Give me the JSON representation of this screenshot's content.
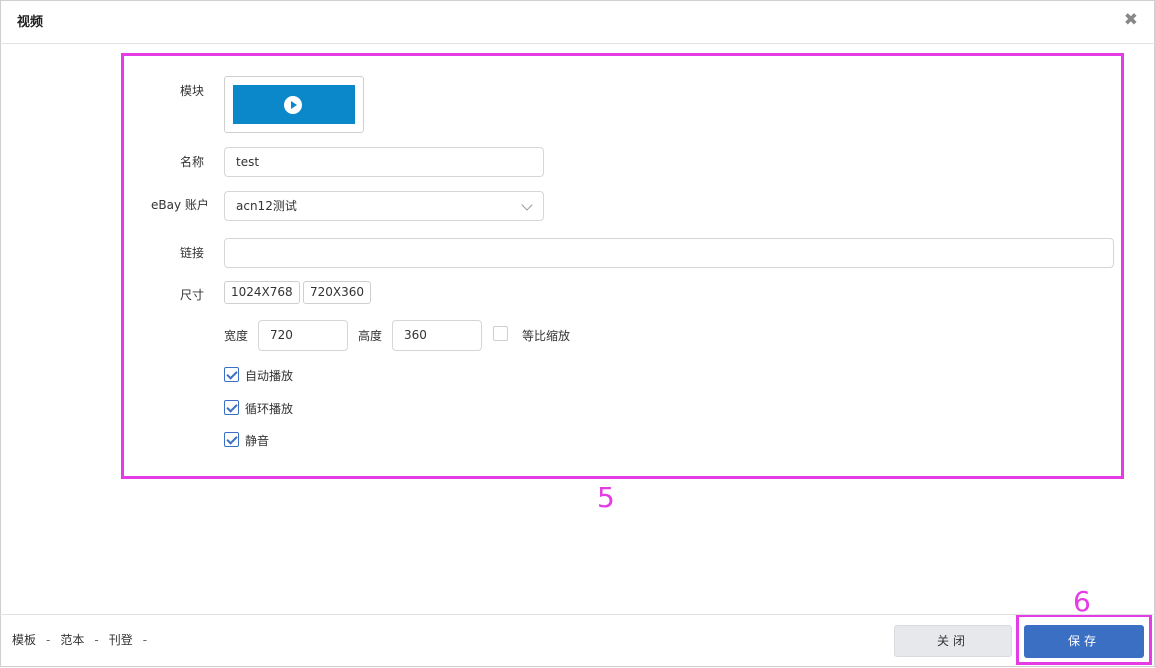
{
  "dialog": {
    "title": "视频",
    "close_glyph": "✖"
  },
  "form": {
    "module_label": "模块",
    "name_label": "名称",
    "name_value": "test",
    "account_label": "eBay 账户",
    "account_value": "acn12测试",
    "link_label": "链接",
    "link_value": "",
    "size_label": "尺寸",
    "size_presets": [
      "1024X768",
      "720X360"
    ],
    "width_label": "宽度",
    "width_value": "720",
    "height_label": "高度",
    "height_value": "360",
    "proportional_label": "等比缩放",
    "proportional_checked": false,
    "autoplay_label": "自动播放",
    "autoplay_checked": true,
    "loop_label": "循环播放",
    "loop_checked": true,
    "mute_label": "静音",
    "mute_checked": true
  },
  "footer": {
    "breadcrumb": [
      "模板",
      "范本",
      "刊登"
    ],
    "separator": "-",
    "close_label": "关闭",
    "save_label": "保存"
  },
  "annotations": {
    "form_marker": "5",
    "save_marker": "6",
    "color": "#e43be4"
  },
  "colors": {
    "accent": "#3a6fc4",
    "banner": "#0a88c9"
  },
  "icons": {
    "close": "close-icon",
    "play": "play-icon",
    "dropdown": "chevron-down-icon",
    "check": "checkmark-icon"
  }
}
